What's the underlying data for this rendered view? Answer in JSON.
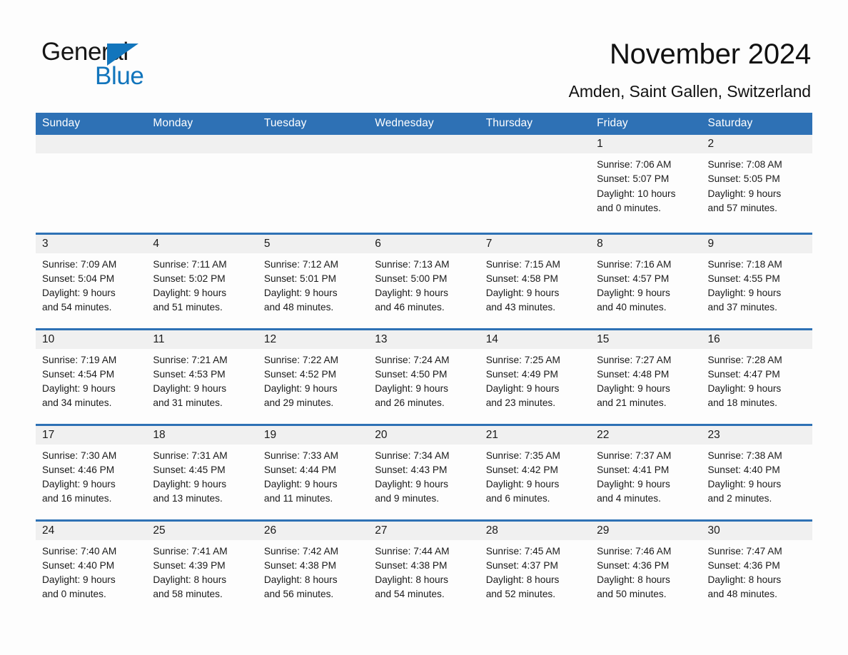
{
  "brand": {
    "name_part1": "General",
    "name_part2": "Blue",
    "triangle_color": "#1275bc",
    "text_color": "#161616"
  },
  "header": {
    "month_title": "November 2024",
    "location": "Amden, Saint Gallen, Switzerland"
  },
  "theme": {
    "header_blue": "#2e71b5",
    "daystrip_gray": "#f0f0f0",
    "page_background": "#fdfdfd",
    "text": "#1a1a1a"
  },
  "calendar": {
    "weekday_headers": [
      "Sunday",
      "Monday",
      "Tuesday",
      "Wednesday",
      "Thursday",
      "Friday",
      "Saturday"
    ],
    "weeks": [
      [
        {
          "day": "",
          "detail": ""
        },
        {
          "day": "",
          "detail": ""
        },
        {
          "day": "",
          "detail": ""
        },
        {
          "day": "",
          "detail": ""
        },
        {
          "day": "",
          "detail": ""
        },
        {
          "day": "1",
          "detail": "Sunrise: 7:06 AM\nSunset: 5:07 PM\nDaylight: 10 hours\nand 0 minutes."
        },
        {
          "day": "2",
          "detail": "Sunrise: 7:08 AM\nSunset: 5:05 PM\nDaylight: 9 hours\nand 57 minutes."
        }
      ],
      [
        {
          "day": "3",
          "detail": "Sunrise: 7:09 AM\nSunset: 5:04 PM\nDaylight: 9 hours\nand 54 minutes."
        },
        {
          "day": "4",
          "detail": "Sunrise: 7:11 AM\nSunset: 5:02 PM\nDaylight: 9 hours\nand 51 minutes."
        },
        {
          "day": "5",
          "detail": "Sunrise: 7:12 AM\nSunset: 5:01 PM\nDaylight: 9 hours\nand 48 minutes."
        },
        {
          "day": "6",
          "detail": "Sunrise: 7:13 AM\nSunset: 5:00 PM\nDaylight: 9 hours\nand 46 minutes."
        },
        {
          "day": "7",
          "detail": "Sunrise: 7:15 AM\nSunset: 4:58 PM\nDaylight: 9 hours\nand 43 minutes."
        },
        {
          "day": "8",
          "detail": "Sunrise: 7:16 AM\nSunset: 4:57 PM\nDaylight: 9 hours\nand 40 minutes."
        },
        {
          "day": "9",
          "detail": "Sunrise: 7:18 AM\nSunset: 4:55 PM\nDaylight: 9 hours\nand 37 minutes."
        }
      ],
      [
        {
          "day": "10",
          "detail": "Sunrise: 7:19 AM\nSunset: 4:54 PM\nDaylight: 9 hours\nand 34 minutes."
        },
        {
          "day": "11",
          "detail": "Sunrise: 7:21 AM\nSunset: 4:53 PM\nDaylight: 9 hours\nand 31 minutes."
        },
        {
          "day": "12",
          "detail": "Sunrise: 7:22 AM\nSunset: 4:52 PM\nDaylight: 9 hours\nand 29 minutes."
        },
        {
          "day": "13",
          "detail": "Sunrise: 7:24 AM\nSunset: 4:50 PM\nDaylight: 9 hours\nand 26 minutes."
        },
        {
          "day": "14",
          "detail": "Sunrise: 7:25 AM\nSunset: 4:49 PM\nDaylight: 9 hours\nand 23 minutes."
        },
        {
          "day": "15",
          "detail": "Sunrise: 7:27 AM\nSunset: 4:48 PM\nDaylight: 9 hours\nand 21 minutes."
        },
        {
          "day": "16",
          "detail": "Sunrise: 7:28 AM\nSunset: 4:47 PM\nDaylight: 9 hours\nand 18 minutes."
        }
      ],
      [
        {
          "day": "17",
          "detail": "Sunrise: 7:30 AM\nSunset: 4:46 PM\nDaylight: 9 hours\nand 16 minutes."
        },
        {
          "day": "18",
          "detail": "Sunrise: 7:31 AM\nSunset: 4:45 PM\nDaylight: 9 hours\nand 13 minutes."
        },
        {
          "day": "19",
          "detail": "Sunrise: 7:33 AM\nSunset: 4:44 PM\nDaylight: 9 hours\nand 11 minutes."
        },
        {
          "day": "20",
          "detail": "Sunrise: 7:34 AM\nSunset: 4:43 PM\nDaylight: 9 hours\nand 9 minutes."
        },
        {
          "day": "21",
          "detail": "Sunrise: 7:35 AM\nSunset: 4:42 PM\nDaylight: 9 hours\nand 6 minutes."
        },
        {
          "day": "22",
          "detail": "Sunrise: 7:37 AM\nSunset: 4:41 PM\nDaylight: 9 hours\nand 4 minutes."
        },
        {
          "day": "23",
          "detail": "Sunrise: 7:38 AM\nSunset: 4:40 PM\nDaylight: 9 hours\nand 2 minutes."
        }
      ],
      [
        {
          "day": "24",
          "detail": "Sunrise: 7:40 AM\nSunset: 4:40 PM\nDaylight: 9 hours\nand 0 minutes."
        },
        {
          "day": "25",
          "detail": "Sunrise: 7:41 AM\nSunset: 4:39 PM\nDaylight: 8 hours\nand 58 minutes."
        },
        {
          "day": "26",
          "detail": "Sunrise: 7:42 AM\nSunset: 4:38 PM\nDaylight: 8 hours\nand 56 minutes."
        },
        {
          "day": "27",
          "detail": "Sunrise: 7:44 AM\nSunset: 4:38 PM\nDaylight: 8 hours\nand 54 minutes."
        },
        {
          "day": "28",
          "detail": "Sunrise: 7:45 AM\nSunset: 4:37 PM\nDaylight: 8 hours\nand 52 minutes."
        },
        {
          "day": "29",
          "detail": "Sunrise: 7:46 AM\nSunset: 4:36 PM\nDaylight: 8 hours\nand 50 minutes."
        },
        {
          "day": "30",
          "detail": "Sunrise: 7:47 AM\nSunset: 4:36 PM\nDaylight: 8 hours\nand 48 minutes."
        }
      ]
    ]
  }
}
